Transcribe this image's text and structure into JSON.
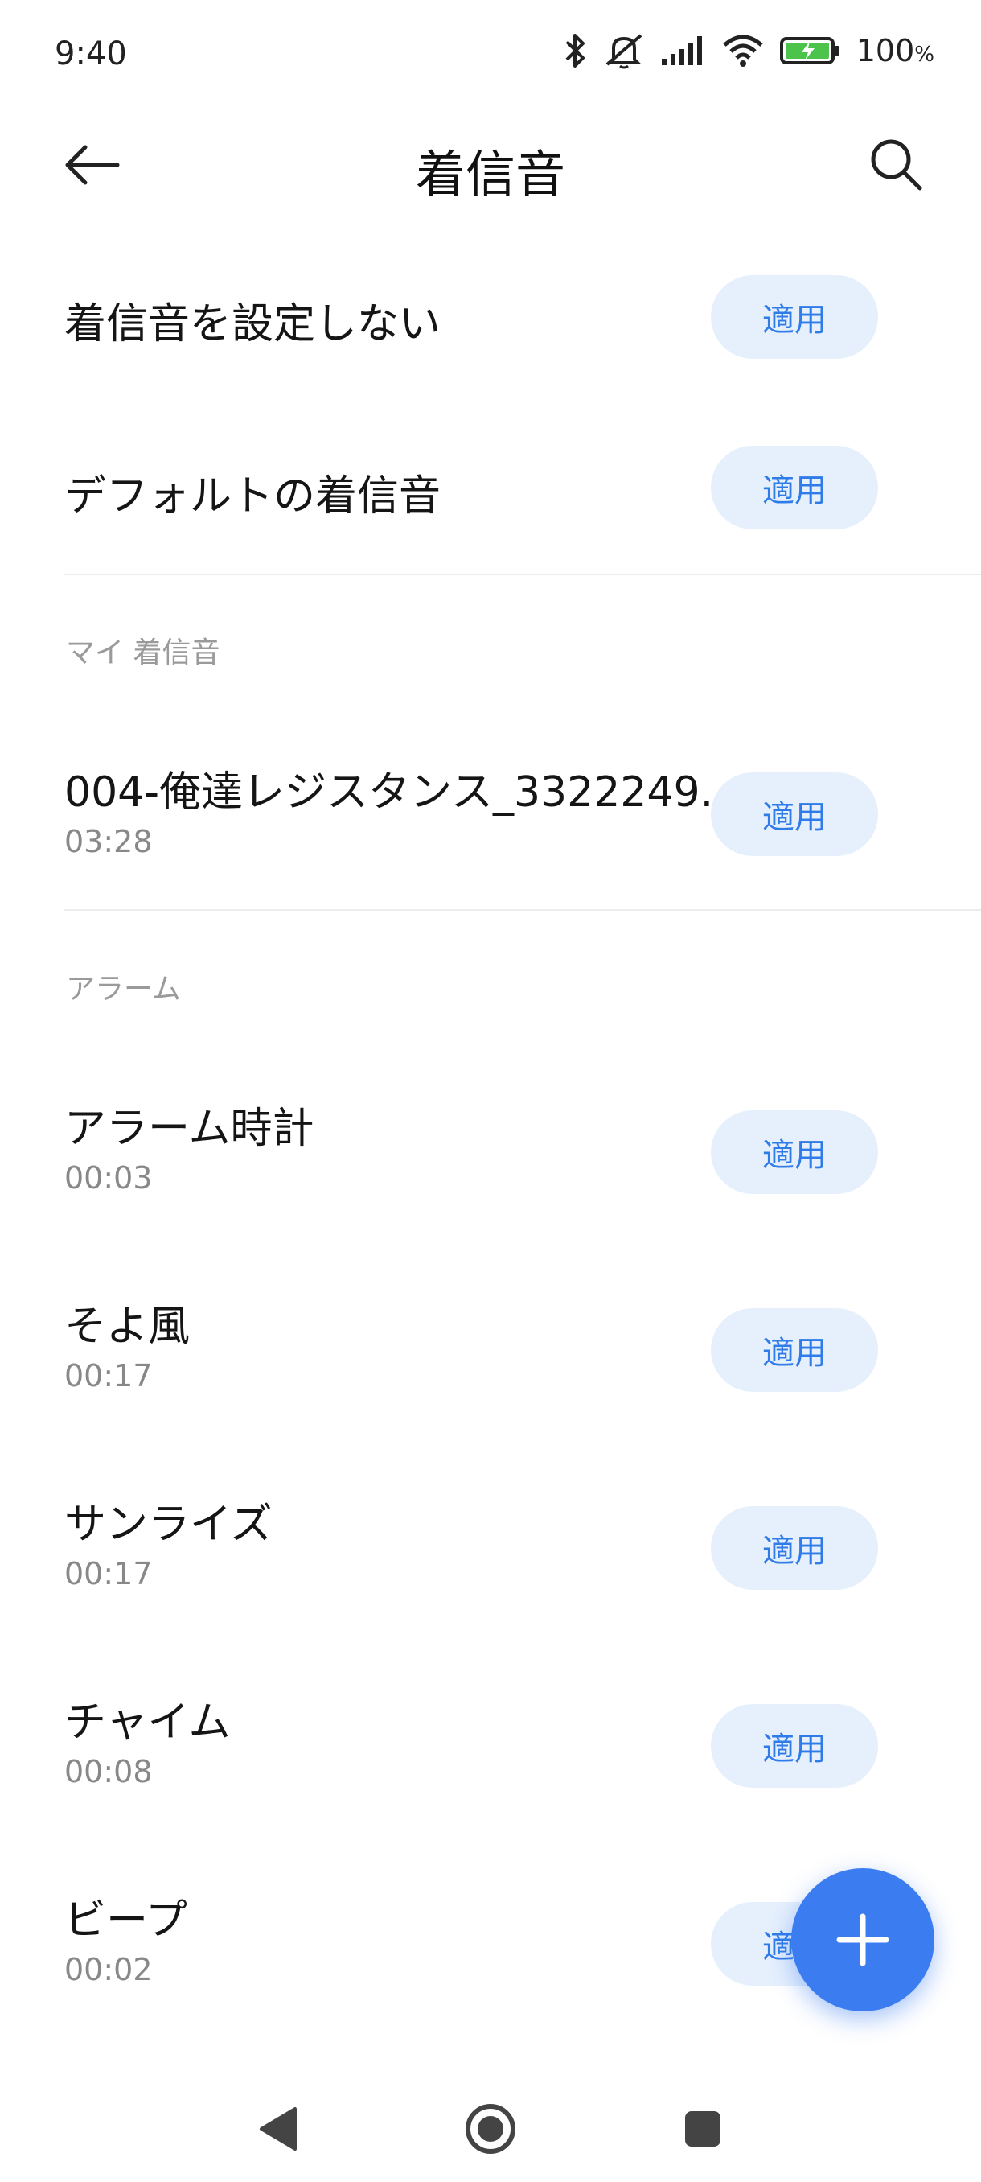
{
  "status": {
    "time": "9:40",
    "battery_pct": "100",
    "battery_unit": "%",
    "icons": [
      "bluetooth-icon",
      "mute-icon",
      "signal-icon",
      "wifi-icon",
      "battery-charging-icon"
    ]
  },
  "header": {
    "title": "着信音",
    "back_icon": "back-arrow-icon",
    "search_icon": "search-icon"
  },
  "apply_label": "適用",
  "top_items": [
    {
      "title": "着信音を設定しない"
    },
    {
      "title": "デフォルトの着信音"
    }
  ],
  "sections": [
    {
      "label": "マイ 着信音",
      "items": [
        {
          "title": "004-俺達レジスタンス_3322249...",
          "duration": "03:28"
        }
      ]
    },
    {
      "label": "アラーム",
      "items": [
        {
          "title": "アラーム時計",
          "duration": "00:03"
        },
        {
          "title": "そよ風",
          "duration": "00:17"
        },
        {
          "title": "サンライズ",
          "duration": "00:17"
        },
        {
          "title": "チャイム",
          "duration": "00:08"
        },
        {
          "title": "ビープ",
          "duration": "00:02"
        }
      ]
    }
  ],
  "fab": {
    "icon": "plus-icon"
  },
  "nav": {
    "icons": [
      "nav-back-icon",
      "nav-home-icon",
      "nav-recents-icon"
    ]
  },
  "colors": {
    "accent": "#3b7df0",
    "apply_bg": "#e6f0fd",
    "apply_text": "#2f7be8",
    "battery_green": "#4cc44c"
  }
}
